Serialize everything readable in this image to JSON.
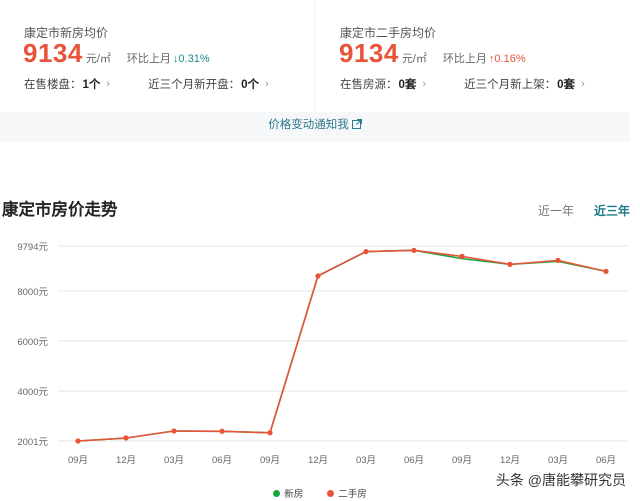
{
  "new_home": {
    "title": "康定市新房均价",
    "price": "9134",
    "unit": "元/㎡",
    "mom_label": "环比上月",
    "mom_arrow": "↓",
    "mom_value": "0.31%",
    "mom_color": "#1d8c8c",
    "stat1_label": "在售楼盘：",
    "stat1_value": "1个",
    "stat2_label": "近三个月新开盘：",
    "stat2_value": "0个"
  },
  "second_hand": {
    "title": "康定市二手房均价",
    "price": "9134",
    "unit": "元/㎡",
    "mom_label": "环比上月",
    "mom_arrow": "↑",
    "mom_value": "0.16%",
    "mom_color": "#e8543a",
    "stat1_label": "在售房源：",
    "stat1_value": "0套",
    "stat2_label": "近三个月新上架：",
    "stat2_value": "0套"
  },
  "notify": {
    "label": "价格变动通知我"
  },
  "trend": {
    "title": "康定市房价走势",
    "tabs": [
      {
        "label": "近一年",
        "active": false
      },
      {
        "label": "近三年",
        "active": true
      }
    ]
  },
  "watermark": "头条 @唐能攀研究员",
  "colors": {
    "accent": "#e8543a",
    "teal": "#1d7b8c",
    "green": "#1aa53a"
  },
  "chart_data": {
    "type": "line",
    "x": [
      "09月",
      "12月",
      "03月",
      "06月",
      "09月",
      "12月",
      "03月",
      "06月",
      "09月",
      "12月",
      "03月",
      "06月"
    ],
    "y_ticks": [
      2001,
      4000,
      6000,
      8000,
      9794
    ],
    "y_tick_labels": [
      "2001元",
      "4000元",
      "6000元",
      "8000元",
      "9794元"
    ],
    "ylim": [
      2001,
      9794
    ],
    "grid": true,
    "legend_position": "bottom-center",
    "series": [
      {
        "name": "新房",
        "color": "#1aa53a",
        "values": [
          2001,
          2120,
          2400,
          2390,
          2330,
          8600,
          9570,
          9620,
          9290,
          9060,
          9180,
          8780
        ]
      },
      {
        "name": "二手房",
        "color": "#e8543a",
        "values": [
          2001,
          2120,
          2400,
          2390,
          2330,
          8600,
          9570,
          9620,
          9380,
          9060,
          9220,
          8780
        ]
      }
    ]
  }
}
